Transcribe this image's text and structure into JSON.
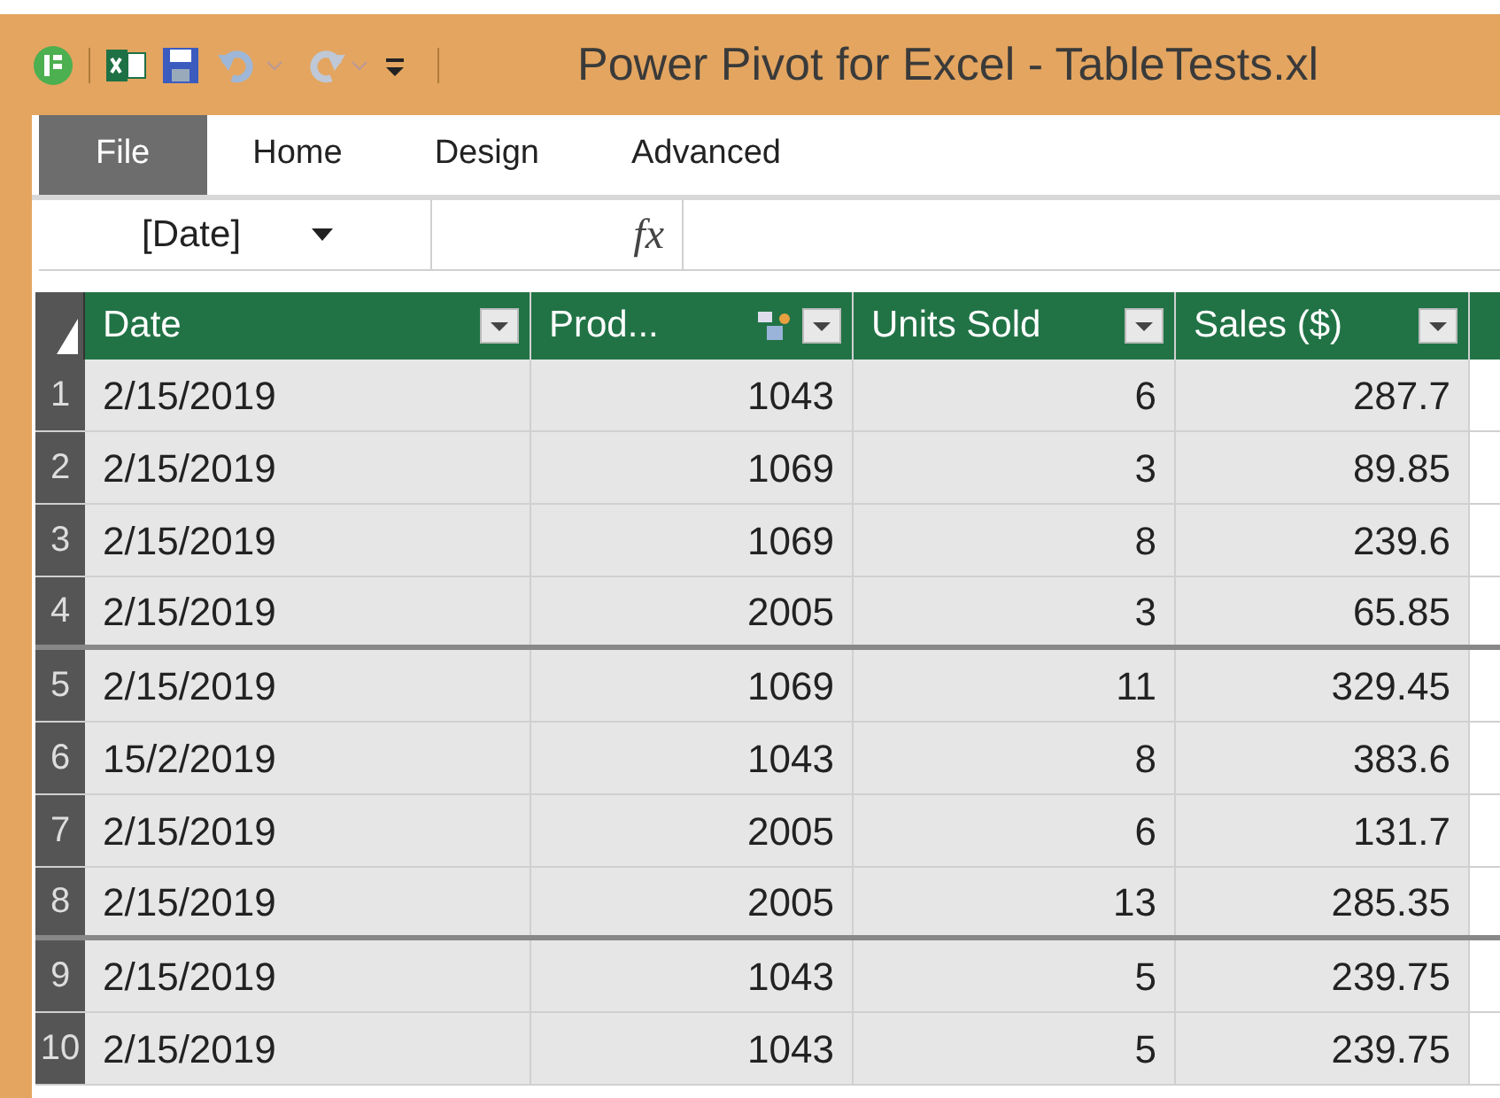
{
  "window": {
    "title": "Power Pivot for Excel - TableTests.xl"
  },
  "tabs": [
    {
      "label": "File",
      "selected": true
    },
    {
      "label": "Home",
      "selected": false
    },
    {
      "label": "Design",
      "selected": false
    },
    {
      "label": "Advanced",
      "selected": false
    }
  ],
  "formula_bar": {
    "name_box": "[Date]",
    "fx": "fx"
  },
  "table": {
    "columns": [
      {
        "label": "Date",
        "kind": "date",
        "relationship_icon": false
      },
      {
        "label": "Prod...",
        "kind": "number",
        "relationship_icon": true
      },
      {
        "label": "Units Sold",
        "kind": "number",
        "relationship_icon": false
      },
      {
        "label": "Sales ($)",
        "kind": "number",
        "relationship_icon": false
      }
    ],
    "rows": [
      {
        "number": "1",
        "cells": [
          "2/15/2019",
          "1043",
          "6",
          "287.7"
        ],
        "divider_below": false
      },
      {
        "number": "2",
        "cells": [
          "2/15/2019",
          "1069",
          "3",
          "89.85"
        ],
        "divider_below": false
      },
      {
        "number": "3",
        "cells": [
          "2/15/2019",
          "1069",
          "8",
          "239.6"
        ],
        "divider_below": false
      },
      {
        "number": "4",
        "cells": [
          "2/15/2019",
          "2005",
          "3",
          "65.85"
        ],
        "divider_below": true
      },
      {
        "number": "5",
        "cells": [
          "2/15/2019",
          "1069",
          "11",
          "329.45"
        ],
        "divider_below": false
      },
      {
        "number": "6",
        "cells": [
          "15/2/2019",
          "1043",
          "8",
          "383.6"
        ],
        "divider_below": false
      },
      {
        "number": "7",
        "cells": [
          "2/15/2019",
          "2005",
          "6",
          "131.7"
        ],
        "divider_below": false
      },
      {
        "number": "8",
        "cells": [
          "2/15/2019",
          "2005",
          "13",
          "285.35"
        ],
        "divider_below": true
      },
      {
        "number": "9",
        "cells": [
          "2/15/2019",
          "1043",
          "5",
          "239.75"
        ],
        "divider_below": false
      },
      {
        "number": "10",
        "cells": [
          "2/15/2019",
          "1043",
          "5",
          "239.75"
        ],
        "divider_below": false
      }
    ]
  }
}
